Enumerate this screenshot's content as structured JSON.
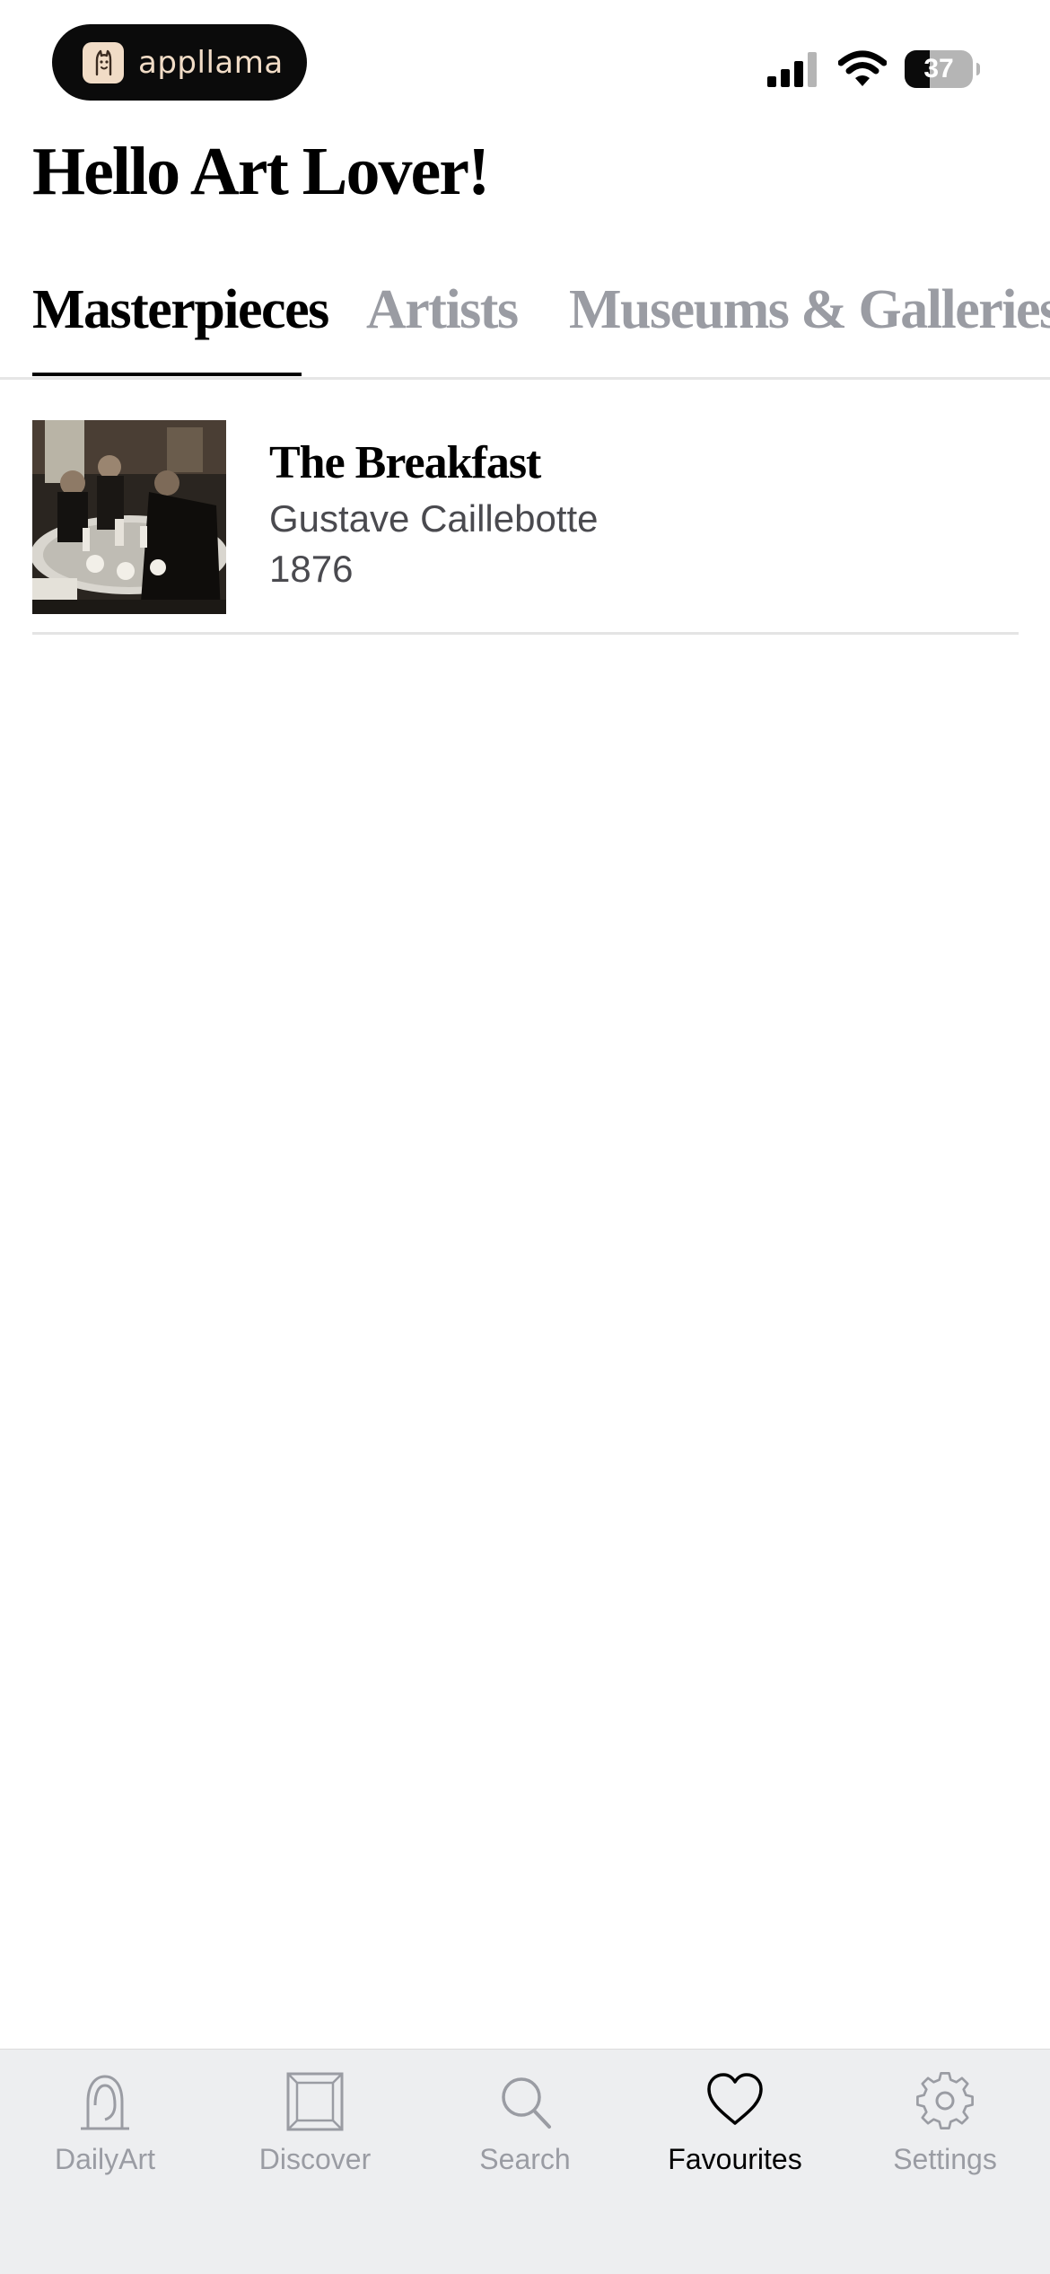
{
  "status_bar": {
    "brand_name": "appllama",
    "battery_level": "37",
    "battery_fraction": 0.37
  },
  "greeting": "Hello Art Lover!",
  "tabs": [
    {
      "label": "Masterpieces",
      "active": true
    },
    {
      "label": "Artists",
      "active": false
    },
    {
      "label": "Museums & Galleries",
      "active": false
    }
  ],
  "favourites": [
    {
      "title": "The Breakfast",
      "artist": "Gustave Caillebotte",
      "year": "1876"
    }
  ],
  "tabbar": {
    "items": [
      {
        "label": "DailyArt",
        "icon": "bust-icon",
        "active": false
      },
      {
        "label": "Discover",
        "icon": "frame-icon",
        "active": false
      },
      {
        "label": "Search",
        "icon": "search-icon",
        "active": false
      },
      {
        "label": "Favourites",
        "icon": "heart-icon",
        "active": true
      },
      {
        "label": "Settings",
        "icon": "gear-icon",
        "active": false
      }
    ]
  },
  "colors": {
    "active_text": "#000000",
    "inactive_text": "#9a9ca3",
    "secondary_text": "#4a4a4f",
    "tabbar_bg": "#edeef0",
    "brand_pill_bg": "#0b0b0b",
    "brand_accent": "#f1dcc6"
  }
}
